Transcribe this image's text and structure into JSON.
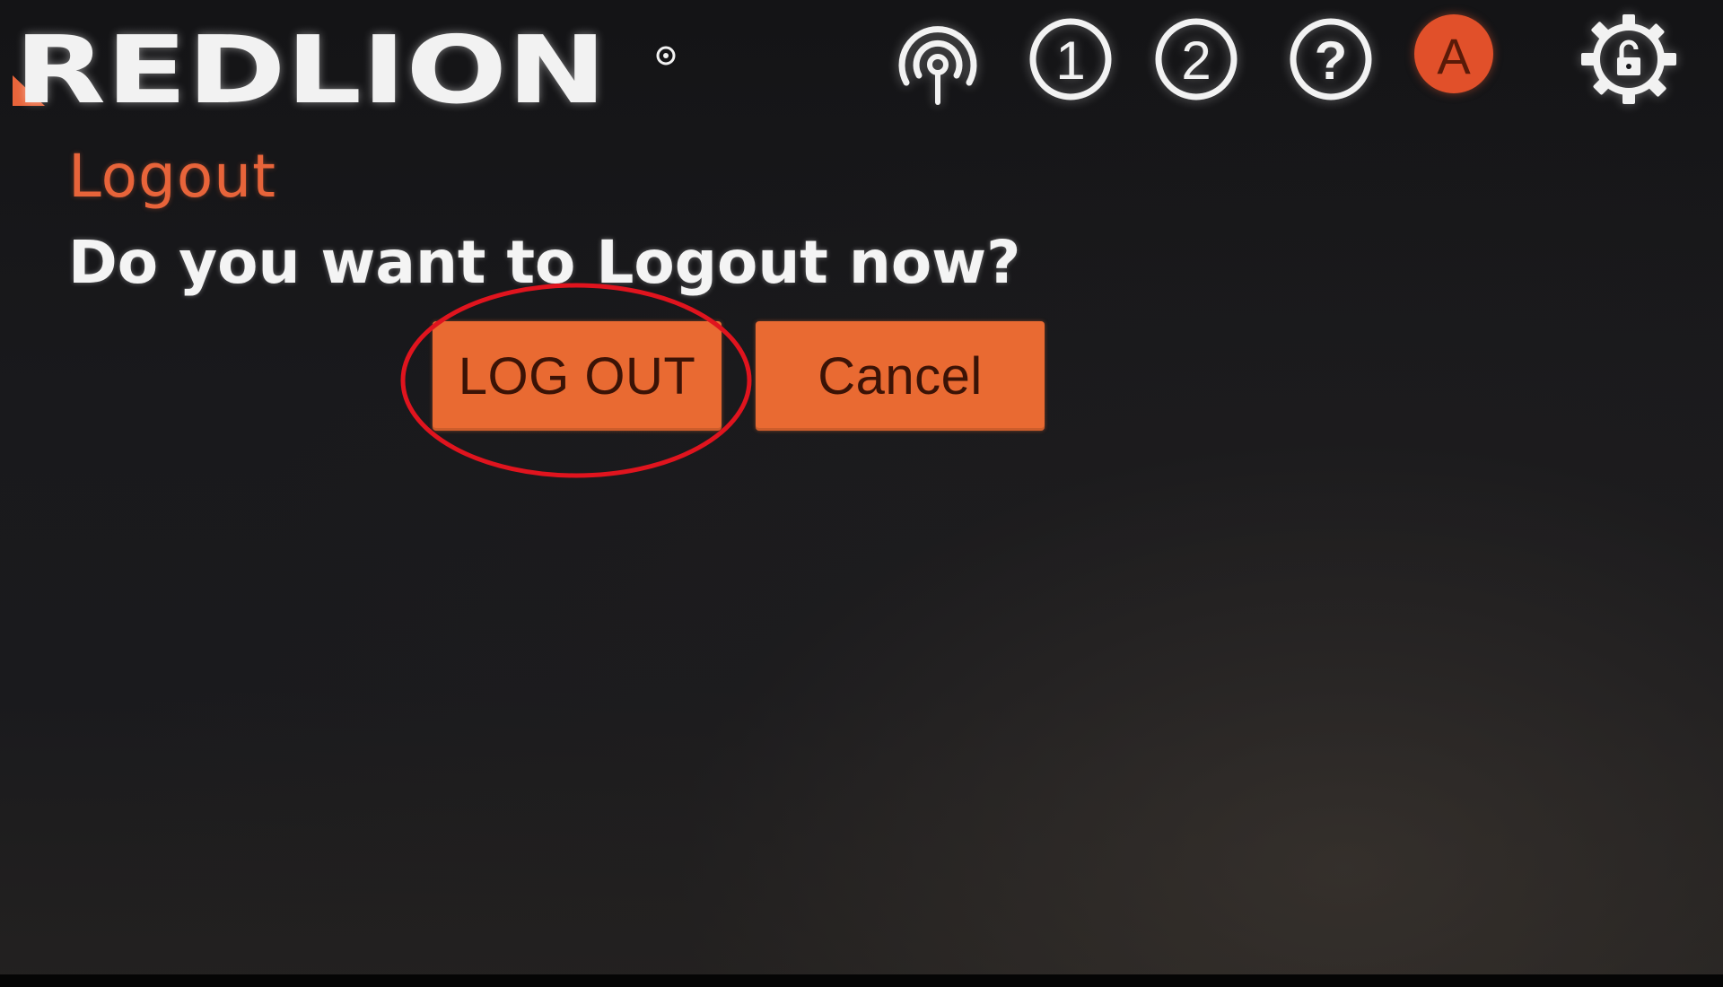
{
  "header": {
    "brand": "REDLION",
    "icons": [
      {
        "name": "signal-icon"
      },
      {
        "name": "number-one-icon",
        "label": "1"
      },
      {
        "name": "number-two-icon",
        "label": "2"
      },
      {
        "name": "help-icon",
        "label": "?"
      },
      {
        "name": "user-avatar",
        "label": "A"
      },
      {
        "name": "settings-lock-icon"
      }
    ]
  },
  "dialog": {
    "title": "Logout",
    "message": "Do you want to Logout now?",
    "logout_label": "LOG OUT",
    "cancel_label": "Cancel"
  },
  "colors": {
    "accent": "#e8643a",
    "button": "#e96a32",
    "button_text": "#3b1306",
    "annotation": "#e0141e",
    "background": "#18181b"
  }
}
